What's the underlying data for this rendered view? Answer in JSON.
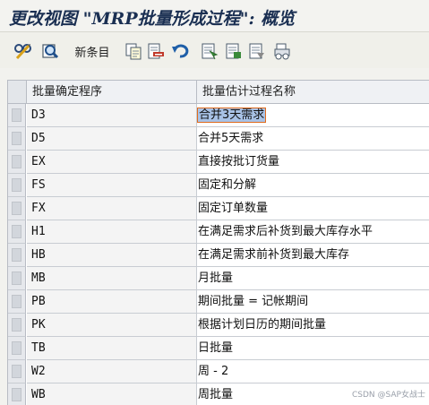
{
  "window": {
    "title": "更改视图 \"MRP批量形成过程\": 概览"
  },
  "toolbar": {
    "new_entries_label": "新条目",
    "icons": [
      "display-change-icon",
      "details-icon",
      "copy-icon",
      "delete-icon",
      "undo-icon",
      "select-all-icon",
      "select-block-icon",
      "deselect-all-icon",
      "print-icon"
    ]
  },
  "table": {
    "columns": [
      "批量确定程序",
      "批量估计过程名称"
    ],
    "rows": [
      {
        "code": "D3",
        "name": "合并3天需求"
      },
      {
        "code": "D5",
        "name": "合并5天需求"
      },
      {
        "code": "EX",
        "name": "直接按批订货量"
      },
      {
        "code": "FS",
        "name": "固定和分解"
      },
      {
        "code": "FX",
        "name": "固定订单数量"
      },
      {
        "code": "H1",
        "name": "在满足需求后补货到最大库存水平"
      },
      {
        "code": "HB",
        "name": "在满足需求前补货到最大库存"
      },
      {
        "code": "MB",
        "name": "月批量"
      },
      {
        "code": "PB",
        "name": "期间批量 = 记帐期间"
      },
      {
        "code": "PK",
        "name": "根据计划日历的期间批量"
      },
      {
        "code": "TB",
        "name": "日批量"
      },
      {
        "code": "W2",
        "name": "周 - 2"
      },
      {
        "code": "WB",
        "name": "周批量"
      }
    ],
    "selected_row": 0
  },
  "watermark": "CSDN @SAP女战士",
  "colors": {
    "title": "#1a2f52",
    "selection": "#a8c2e6",
    "focus_outline": "#e06a1c"
  }
}
